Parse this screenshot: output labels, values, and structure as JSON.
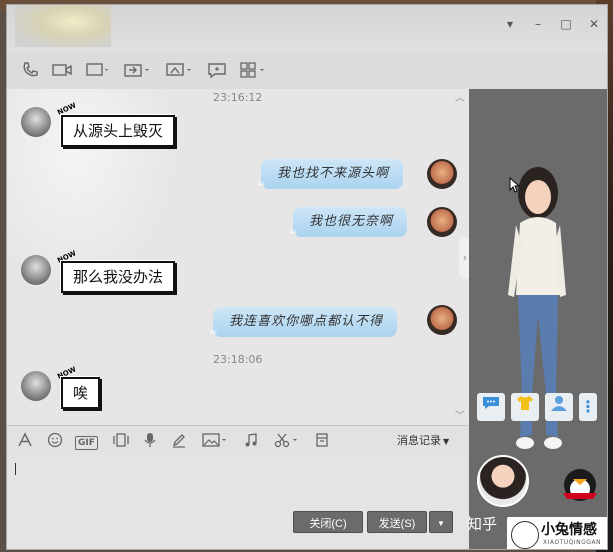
{
  "window": {
    "controls": {
      "menu": "▾",
      "minimize": "–",
      "maximize": "□",
      "close": "✕"
    }
  },
  "toolbar": {
    "icons": [
      "phone-icon",
      "video-icon",
      "screen-share-icon",
      "file-transfer-icon",
      "remote-desktop-icon",
      "chat-bubble-icon",
      "apps-grid-icon"
    ]
  },
  "chat": {
    "top_timestamp": "23:16:12",
    "messages": [
      {
        "side": "left",
        "tag": "NOW",
        "text": "从源头上毁灭"
      },
      {
        "side": "right",
        "text": "我也找不来源头啊"
      },
      {
        "side": "right",
        "text": "我也很无奈啊"
      },
      {
        "side": "left",
        "tag": "NOW",
        "text": "那么我没办法"
      },
      {
        "side": "right",
        "text": "我连喜欢你哪点都认不得"
      },
      {
        "side": "center",
        "text": "23:18:06"
      },
      {
        "side": "left",
        "tag": "NOW",
        "text": "唉"
      }
    ]
  },
  "input_toolbar": {
    "history_label": "消息记录",
    "gif_label": "GIF"
  },
  "buttons": {
    "close_label": "关闭(C)",
    "send_label": "发送(S)",
    "send_dropdown": "▼"
  },
  "watermark": {
    "zhihu": "知乎",
    "brand_cn": "小兔情感",
    "brand_en": "XIAOTUQINGGAN"
  },
  "colors": {
    "bubble_blue": "#b8dcf4",
    "panel_gray": "#6b6b6b",
    "window_gray": "#dcdcdc"
  }
}
